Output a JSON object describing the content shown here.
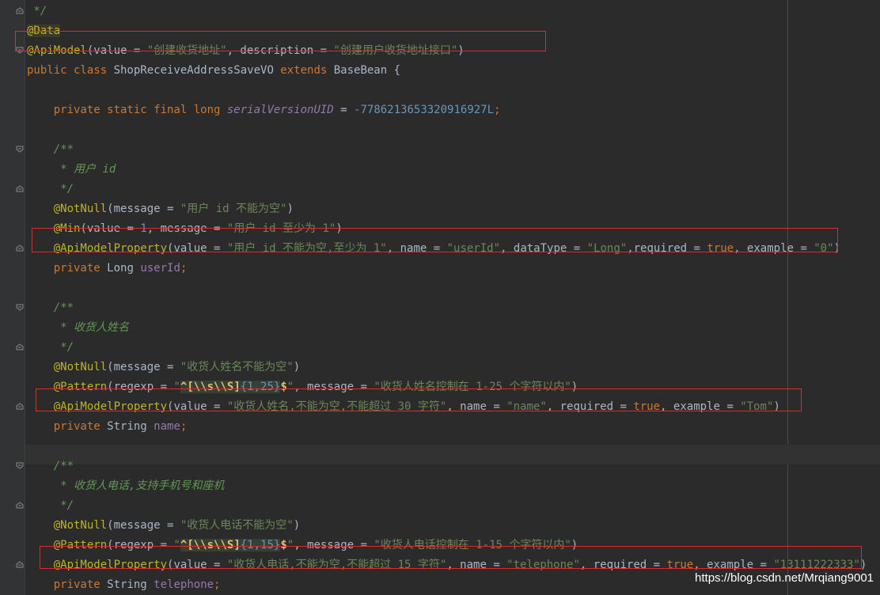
{
  "editor": {
    "lines": [
      {
        "id": "l0",
        "segments": [
          {
            "t": " */",
            "c": "cmt"
          }
        ]
      },
      {
        "id": "l1",
        "segments": [
          {
            "t": "@Data",
            "c": "ann data-hl"
          }
        ]
      },
      {
        "id": "l2",
        "segments": [
          {
            "t": "@ApiModel",
            "c": "ann"
          },
          {
            "t": "(value = ",
            "c": ""
          },
          {
            "t": "\"创建收货地址\"",
            "c": "str"
          },
          {
            "t": ", description = ",
            "c": ""
          },
          {
            "t": "\"创建用户收货地址接口\"",
            "c": "str"
          },
          {
            "t": ")",
            "c": ""
          }
        ]
      },
      {
        "id": "l3",
        "segments": [
          {
            "t": "public class ",
            "c": "kw"
          },
          {
            "t": "ShopReceiveAddressSaveVO ",
            "c": ""
          },
          {
            "t": "extends ",
            "c": "kw"
          },
          {
            "t": "BaseBean {",
            "c": ""
          }
        ]
      },
      {
        "id": "l4",
        "segments": []
      },
      {
        "id": "l5",
        "segments": [
          {
            "t": "    private static final long ",
            "c": "kw"
          },
          {
            "t": "serialVersionUID",
            "c": "fld-it"
          },
          {
            "t": " = ",
            "c": ""
          },
          {
            "t": "-7786213653320916927L",
            "c": "num"
          },
          {
            "t": ";",
            "c": "kw"
          }
        ]
      },
      {
        "id": "l6",
        "segments": []
      },
      {
        "id": "l7",
        "segments": [
          {
            "t": "    /**",
            "c": "cmt"
          }
        ]
      },
      {
        "id": "l8",
        "segments": [
          {
            "t": "     * 用户 ",
            "c": "cmt"
          },
          {
            "t": "id",
            "c": "cmt-tag"
          }
        ]
      },
      {
        "id": "l9",
        "segments": [
          {
            "t": "     */",
            "c": "cmt"
          }
        ]
      },
      {
        "id": "l10",
        "segments": [
          {
            "t": "    ",
            "c": ""
          },
          {
            "t": "@NotNull",
            "c": "ann"
          },
          {
            "t": "(message = ",
            "c": ""
          },
          {
            "t": "\"用户 id 不能为空\"",
            "c": "str"
          },
          {
            "t": ")",
            "c": ""
          }
        ]
      },
      {
        "id": "l11",
        "segments": [
          {
            "t": "    ",
            "c": ""
          },
          {
            "t": "@Min",
            "c": "ann"
          },
          {
            "t": "(value = ",
            "c": ""
          },
          {
            "t": "1",
            "c": "num"
          },
          {
            "t": ", message = ",
            "c": ""
          },
          {
            "t": "\"用户 id 至少为 1\"",
            "c": "str"
          },
          {
            "t": ")",
            "c": ""
          }
        ]
      },
      {
        "id": "l12",
        "segments": [
          {
            "t": "    ",
            "c": ""
          },
          {
            "t": "@ApiModelProperty",
            "c": "ann"
          },
          {
            "t": "(value = ",
            "c": ""
          },
          {
            "t": "\"用户 id 不能为空,至少为 1\"",
            "c": "str"
          },
          {
            "t": ", name = ",
            "c": ""
          },
          {
            "t": "\"userId\"",
            "c": "str"
          },
          {
            "t": ", dataType = ",
            "c": ""
          },
          {
            "t": "\"Long\"",
            "c": "str"
          },
          {
            "t": ",required = ",
            "c": ""
          },
          {
            "t": "true",
            "c": "kw"
          },
          {
            "t": ", example = ",
            "c": ""
          },
          {
            "t": "\"0\"",
            "c": "str"
          },
          {
            "t": ")",
            "c": ""
          }
        ]
      },
      {
        "id": "l13",
        "segments": [
          {
            "t": "    private ",
            "c": "kw"
          },
          {
            "t": "Long ",
            "c": ""
          },
          {
            "t": "userId",
            "c": "fld"
          },
          {
            "t": ";",
            "c": "kw"
          }
        ]
      },
      {
        "id": "l14",
        "segments": []
      },
      {
        "id": "l15",
        "segments": [
          {
            "t": "    /**",
            "c": "cmt"
          }
        ]
      },
      {
        "id": "l16",
        "segments": [
          {
            "t": "     * 收货人姓名",
            "c": "cmt"
          }
        ]
      },
      {
        "id": "l17",
        "segments": [
          {
            "t": "     */",
            "c": "cmt"
          }
        ]
      },
      {
        "id": "l18",
        "segments": [
          {
            "t": "    ",
            "c": ""
          },
          {
            "t": "@NotNull",
            "c": "ann"
          },
          {
            "t": "(message = ",
            "c": ""
          },
          {
            "t": "\"收货人姓名不能为空\"",
            "c": "str"
          },
          {
            "t": ")",
            "c": ""
          }
        ]
      },
      {
        "id": "l19",
        "segments": [
          {
            "t": "    ",
            "c": ""
          },
          {
            "t": "@Pattern",
            "c": "ann"
          },
          {
            "t": "(regexp = ",
            "c": ""
          },
          {
            "t": "\"",
            "c": "str"
          },
          {
            "t": "^[\\\\s\\\\S]",
            "c": "regex"
          },
          {
            "t": "{1,25}",
            "c": "regex-q"
          },
          {
            "t": "$",
            "c": "dollar"
          },
          {
            "t": "\"",
            "c": "str"
          },
          {
            "t": ", message = ",
            "c": ""
          },
          {
            "t": "\"收货人姓名控制在 1-25 个字符以内\"",
            "c": "str"
          },
          {
            "t": ")",
            "c": ""
          }
        ]
      },
      {
        "id": "l20",
        "segments": [
          {
            "t": "    ",
            "c": ""
          },
          {
            "t": "@ApiModelProperty",
            "c": "ann"
          },
          {
            "t": "(value = ",
            "c": ""
          },
          {
            "t": "\"收货人姓名,不能为空,不能超过 30 字符\"",
            "c": "str"
          },
          {
            "t": ", name = ",
            "c": ""
          },
          {
            "t": "\"name\"",
            "c": "str"
          },
          {
            "t": ", required = ",
            "c": ""
          },
          {
            "t": "true",
            "c": "kw"
          },
          {
            "t": ", example = ",
            "c": ""
          },
          {
            "t": "\"Tom\"",
            "c": "str"
          },
          {
            "t": ")",
            "c": ""
          }
        ]
      },
      {
        "id": "l21",
        "segments": [
          {
            "t": "    private ",
            "c": "kw"
          },
          {
            "t": "String ",
            "c": ""
          },
          {
            "t": "name",
            "c": "fld"
          },
          {
            "t": ";",
            "c": "kw"
          }
        ]
      },
      {
        "id": "l22",
        "segments": []
      },
      {
        "id": "l23",
        "segments": [
          {
            "t": "    /**",
            "c": "cmt"
          }
        ]
      },
      {
        "id": "l24",
        "segments": [
          {
            "t": "     * 收货人电话,支持手机号和座机",
            "c": "cmt"
          }
        ]
      },
      {
        "id": "l25",
        "segments": [
          {
            "t": "     */",
            "c": "cmt"
          }
        ]
      },
      {
        "id": "l26",
        "segments": [
          {
            "t": "    ",
            "c": ""
          },
          {
            "t": "@NotNull",
            "c": "ann"
          },
          {
            "t": "(message = ",
            "c": ""
          },
          {
            "t": "\"收货人电话不能为空\"",
            "c": "str"
          },
          {
            "t": ")",
            "c": ""
          }
        ]
      },
      {
        "id": "l27",
        "segments": [
          {
            "t": "    ",
            "c": ""
          },
          {
            "t": "@Pattern",
            "c": "ann"
          },
          {
            "t": "(regexp = ",
            "c": ""
          },
          {
            "t": "\"",
            "c": "str"
          },
          {
            "t": "^[\\\\s\\\\S]",
            "c": "regex"
          },
          {
            "t": "{1,15}",
            "c": "regex-q"
          },
          {
            "t": "$",
            "c": "dollar"
          },
          {
            "t": "\"",
            "c": "str"
          },
          {
            "t": ", message = ",
            "c": ""
          },
          {
            "t": "\"收货人电话控制在 1-15 个字符以内\"",
            "c": "str"
          },
          {
            "t": ")",
            "c": ""
          }
        ]
      },
      {
        "id": "l28",
        "segments": [
          {
            "t": "    ",
            "c": ""
          },
          {
            "t": "@ApiModelProperty",
            "c": "ann"
          },
          {
            "t": "(value = ",
            "c": ""
          },
          {
            "t": "\"收货人电话,不能为空,不能超过 15 字符\"",
            "c": "str"
          },
          {
            "t": ", name = ",
            "c": ""
          },
          {
            "t": "\"telephone\"",
            "c": "str"
          },
          {
            "t": ", required = ",
            "c": ""
          },
          {
            "t": "true",
            "c": "kw"
          },
          {
            "t": ", example = ",
            "c": ""
          },
          {
            "t": "\"13111222333\"",
            "c": "str"
          },
          {
            "t": ")",
            "c": ""
          }
        ]
      },
      {
        "id": "l29",
        "segments": [
          {
            "t": "    private ",
            "c": "kw"
          },
          {
            "t": "String ",
            "c": ""
          },
          {
            "t": "telephone",
            "c": "fld"
          },
          {
            "t": ";",
            "c": "kw"
          }
        ]
      }
    ]
  },
  "colors": {
    "background": "#2b2b2b",
    "keyword": "#cc7832",
    "annotation": "#bbb529",
    "string": "#6a8759",
    "number": "#6897bb",
    "field": "#9876aa",
    "comment": "#629755",
    "highlight_box": "#e0282d"
  },
  "watermark": "https://blog.csdn.net/Mrqiang9001"
}
